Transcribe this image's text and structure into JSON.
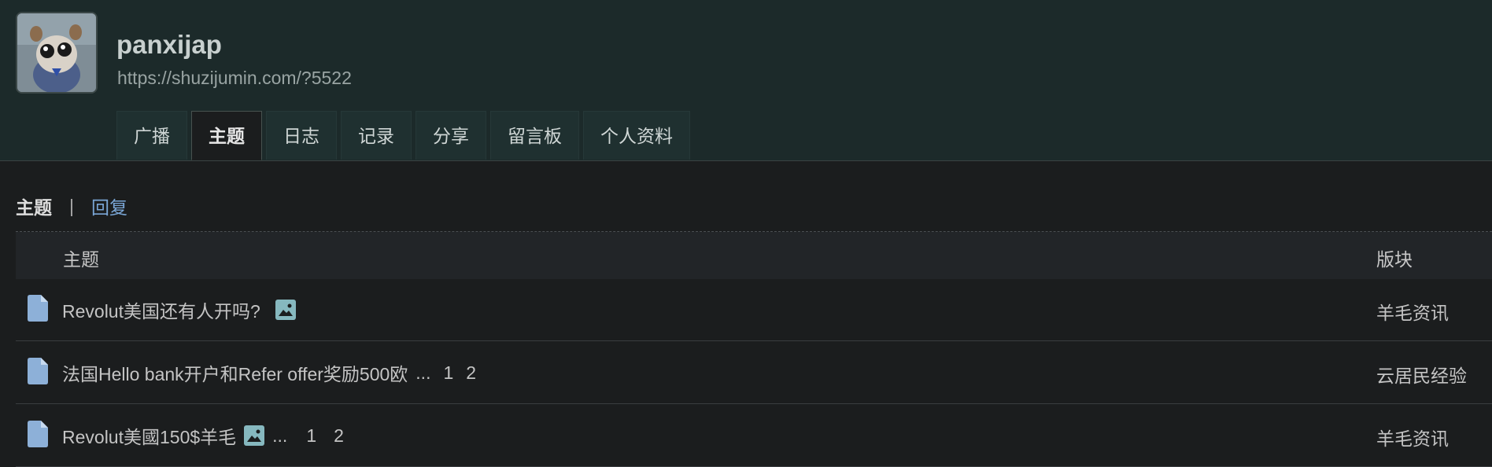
{
  "profile": {
    "username": "panxijap",
    "url": "https://shuzijumin.com/?5522"
  },
  "tabs": [
    {
      "label": "广播"
    },
    {
      "label": "主题",
      "active": true
    },
    {
      "label": "日志"
    },
    {
      "label": "记录"
    },
    {
      "label": "分享"
    },
    {
      "label": "留言板"
    },
    {
      "label": "个人资料"
    }
  ],
  "subnav": {
    "current": "主题",
    "separator": "|",
    "link": "回复"
  },
  "table": {
    "headers": {
      "topic": "主题",
      "forum": "版块"
    },
    "rows": [
      {
        "title": "Revolut美国还有人开吗?",
        "has_image": true,
        "ellipsis": "",
        "pages": [],
        "forum": "羊毛资讯"
      },
      {
        "title": "法国Hello bank开户和Refer offer奖励500欧",
        "has_image": false,
        "ellipsis": "...",
        "pages": [
          "1",
          "2"
        ],
        "forum": "云居民经验"
      },
      {
        "title": "Revolut美國150$羊毛",
        "has_image": true,
        "ellipsis": "...",
        "pages": [
          "1",
          "2"
        ],
        "forum": "羊毛资讯"
      }
    ]
  },
  "colors": {
    "header_bg": "#1c2a2a",
    "page_bg": "#1b1d1e",
    "link": "#7aa6d6",
    "doc_icon": "#8db0d8",
    "image_icon": "#86b8bf"
  }
}
